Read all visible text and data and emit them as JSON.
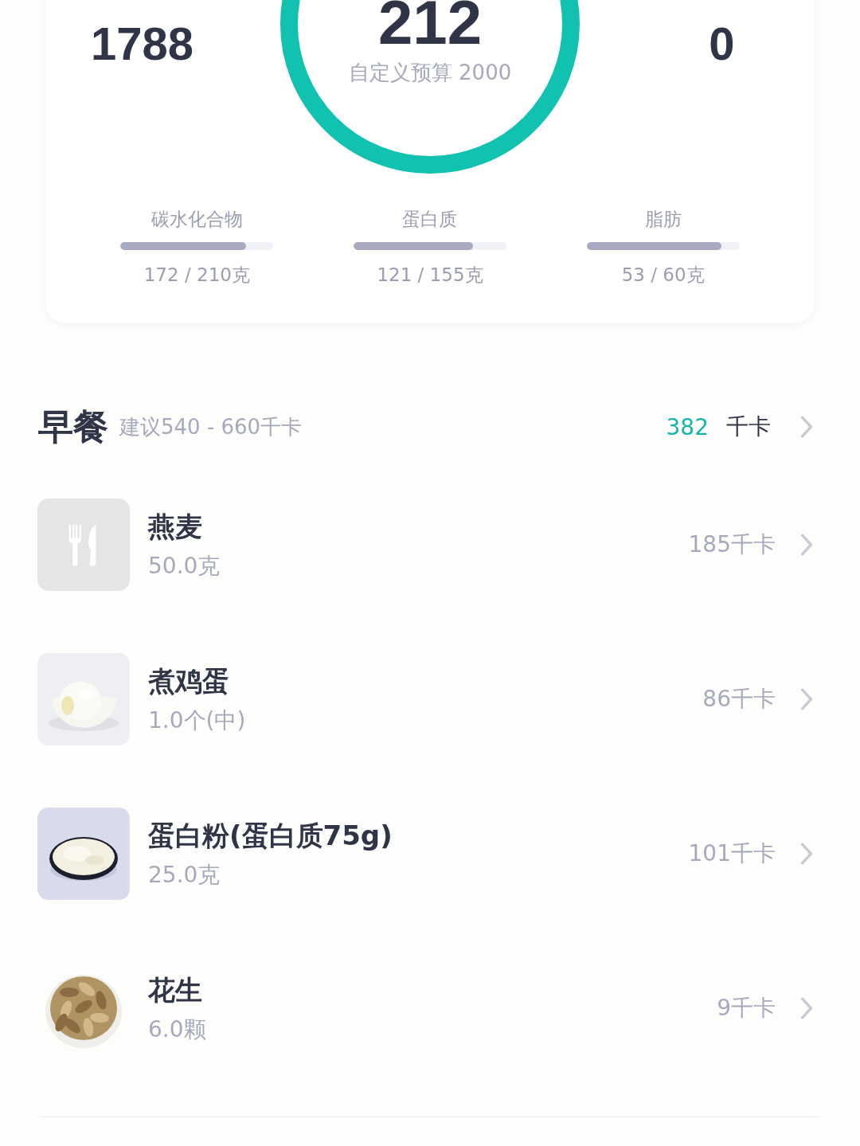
{
  "summary": {
    "intake": "1788",
    "remaining": "212",
    "budget": "自定义预算 2000",
    "burned": "0"
  },
  "macros": [
    {
      "label": "碳水化合物",
      "level": 0.82,
      "reading": "172 / 210克"
    },
    {
      "label": "蛋白质",
      "level": 0.78,
      "reading": "121 / 155克"
    },
    {
      "label": "脂肪",
      "level": 0.88,
      "reading": "53 / 60克"
    }
  ],
  "meal": {
    "title": "早餐",
    "hint": "建议540 - 660千卡",
    "total": "382",
    "unit": "千卡"
  },
  "foods": [
    {
      "name": "燕麦",
      "amount": "50.0克",
      "kcal": "185千卡",
      "kind": "placeholder"
    },
    {
      "name": "煮鸡蛋",
      "amount": "1.0个(中)",
      "kcal": "86千卡",
      "kind": "picture"
    },
    {
      "name": "蛋白粉(蛋白质75g)",
      "amount": "25.0克",
      "kcal": "101千卡",
      "kind": "picture"
    },
    {
      "name": "花生",
      "amount": "6.0颗",
      "kcal": "9千卡",
      "kind": "picture"
    }
  ]
}
